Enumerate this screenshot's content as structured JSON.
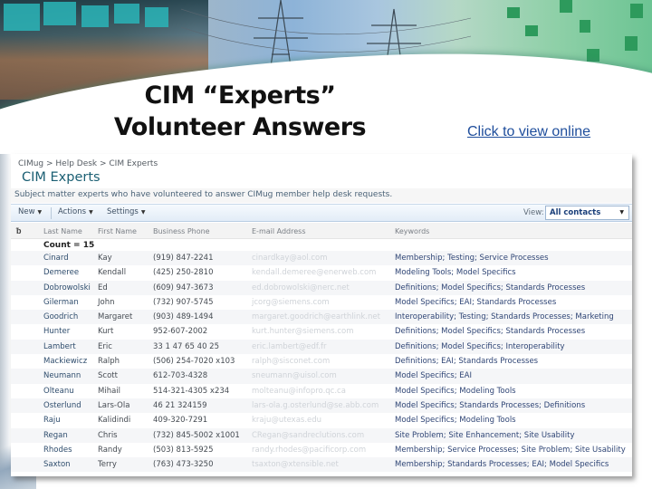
{
  "slide": {
    "title_line1": "CIM “Experts”",
    "title_line2": "Volunteer Answers",
    "view_online_link": "Click to view online"
  },
  "sharepoint": {
    "breadcrumb": "CIMug > Help Desk > CIM Experts",
    "page_title": "CIM Experts",
    "description": "Subject matter experts who have volunteered to answer CIMug member help desk requests.",
    "toolbar": {
      "new_label": "New",
      "actions_label": "Actions",
      "settings_label": "Settings",
      "view_label": "View:",
      "view_selected": "All contacts"
    },
    "columns": {
      "attachment_icon": "paperclip-icon",
      "last_name": "Last Name",
      "first_name": "First Name",
      "business_phone": "Business Phone",
      "email": "E-mail Address",
      "keywords": "Keywords"
    },
    "count_label": "Count = 15",
    "rows": [
      {
        "last": "Cinard",
        "first": "Kay",
        "phone": "(919) 847-2241",
        "email": "cinardkay@aol.com",
        "keywords": "Membership; Testing; Service Processes"
      },
      {
        "last": "Demeree",
        "first": "Kendall",
        "phone": "(425) 250-2810",
        "email": "kendall.demeree@enerweb.com",
        "keywords": "Modeling Tools; Model Specifics"
      },
      {
        "last": "Dobrowolski",
        "first": "Ed",
        "phone": "(609) 947-3673",
        "email": "ed.dobrowolski@nerc.net",
        "keywords": "Definitions; Model Specifics; Standards Processes"
      },
      {
        "last": "Gilerman",
        "first": "John",
        "phone": "(732) 907-5745",
        "email": "jcorg@siemens.com",
        "keywords": "Model Specifics; EAI; Standards Processes"
      },
      {
        "last": "Goodrich",
        "first": "Margaret",
        "phone": "(903) 489-1494",
        "email": "margaret.goodrich@earthlink.net",
        "keywords": "Interoperability; Testing; Standards Processes; Marketing"
      },
      {
        "last": "Hunter",
        "first": "Kurt",
        "phone": "952-607-2002",
        "email": "kurt.hunter@siemens.com",
        "keywords": "Definitions; Model Specifics; Standards Processes"
      },
      {
        "last": "Lambert",
        "first": "Eric",
        "phone": "33 1 47 65 40 25",
        "email": "eric.lambert@edf.fr",
        "keywords": "Definitions; Model Specifics; Interoperability"
      },
      {
        "last": "Mackiewicz",
        "first": "Ralph",
        "phone": "(506) 254-7020 x103",
        "email": "ralph@sisconet.com",
        "keywords": "Definitions; EAI; Standards Processes"
      },
      {
        "last": "Neumann",
        "first": "Scott",
        "phone": "612-703-4328",
        "email": "sneumann@uisol.com",
        "keywords": "Model Specifics; EAI"
      },
      {
        "last": "Olteanu",
        "first": "Mihail",
        "phone": "514-321-4305 x234",
        "email": "molteanu@infopro.qc.ca",
        "keywords": "Model Specifics; Modeling Tools"
      },
      {
        "last": "Osterlund",
        "first": "Lars-Ola",
        "phone": "46 21 324159",
        "email": "lars-ola.g.osterlund@se.abb.com",
        "keywords": "Model Specifics; Standards Processes; Definitions"
      },
      {
        "last": "Raju",
        "first": "Kalidindi",
        "phone": "409-320-7291",
        "email": "kraju@utexas.edu",
        "keywords": "Model Specifics; Modeling Tools"
      },
      {
        "last": "Regan",
        "first": "Chris",
        "phone": "(732) 845-5002 x1001",
        "email": "CRegan@sandreclutions.com",
        "keywords": "Site Problem; Site Enhancement; Site Usability"
      },
      {
        "last": "Rhodes",
        "first": "Randy",
        "phone": "(503) 813-5925",
        "email": "randy.rhodes@pacificorp.com",
        "keywords": "Membership; Service Processes; Site Problem; Site Usability"
      },
      {
        "last": "Saxton",
        "first": "Terry",
        "phone": "(763) 473-3250",
        "email": "tsaxton@xtensible.net",
        "keywords": "Membership; Standards Processes; EAI; Model Specifics"
      }
    ]
  },
  "colors": {
    "link": "#1f4e9c",
    "sp_title": "#1b5f73",
    "keywords_text": "#2f4575"
  }
}
